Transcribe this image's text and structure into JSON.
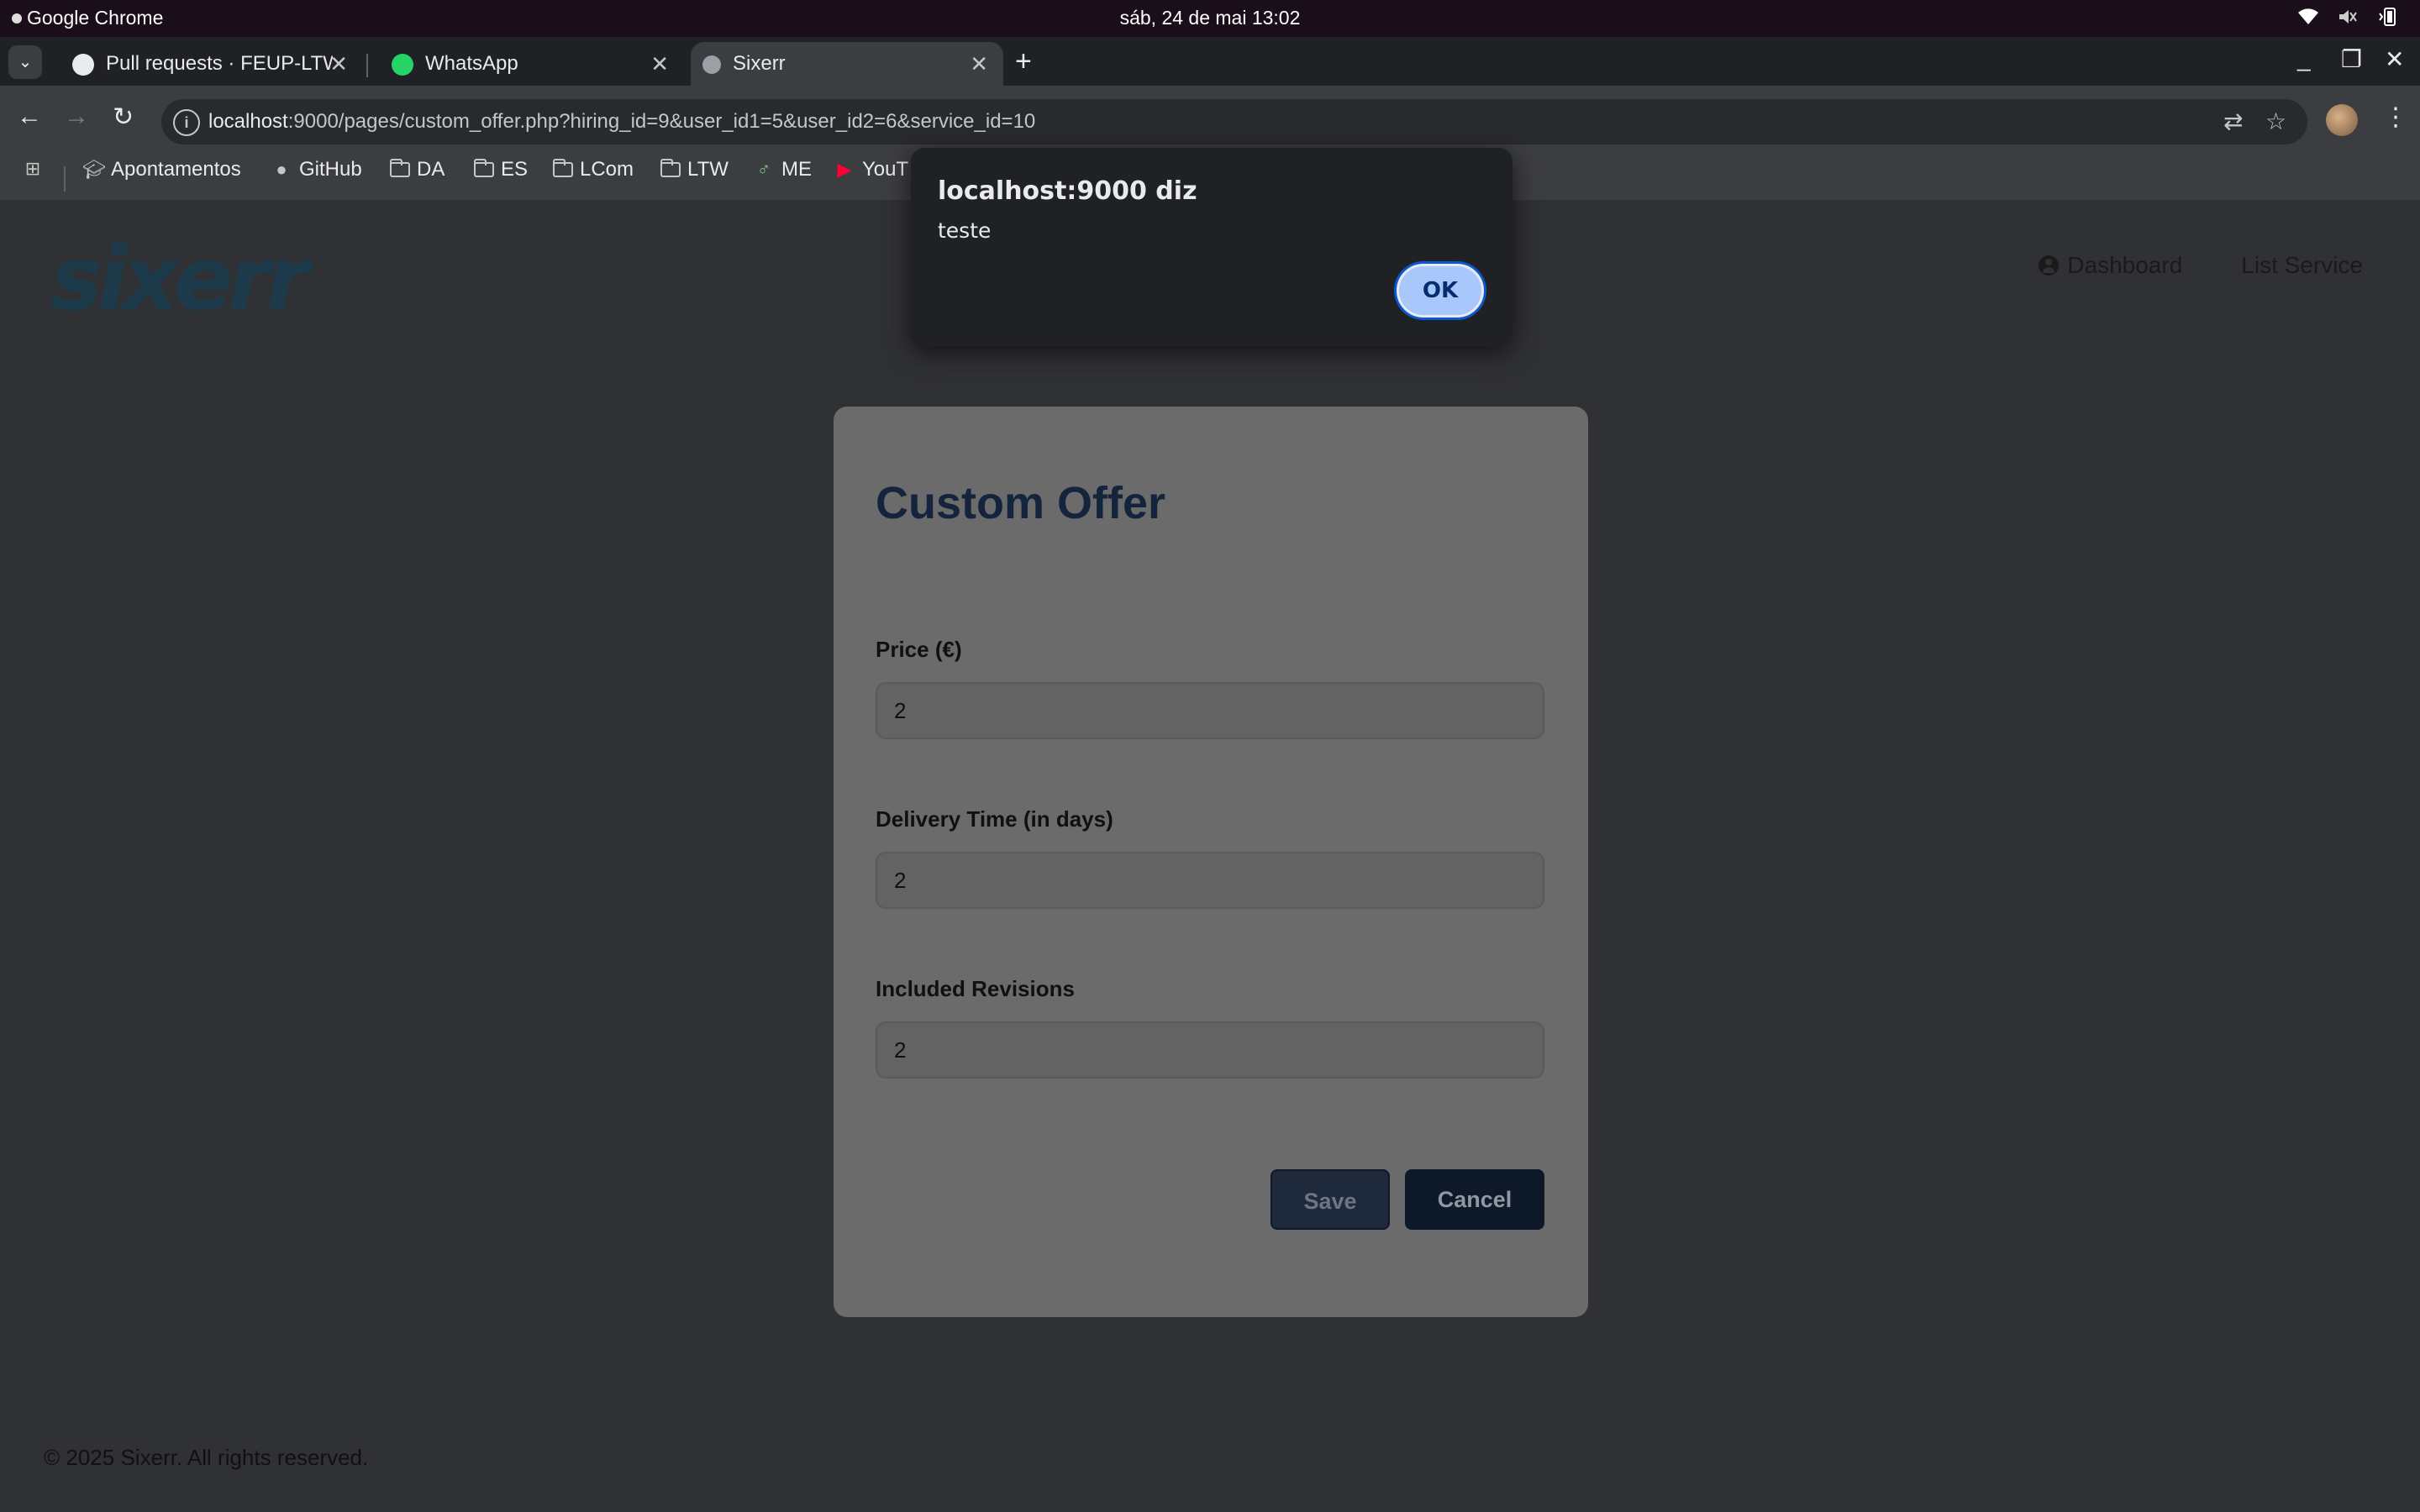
{
  "os": {
    "app_name": "Google Chrome",
    "clock": "sáb, 24 de mai  13:02"
  },
  "tabs": [
    {
      "title": "Pull requests · FEUP-LTW",
      "icon": "github-icon",
      "active": false
    },
    {
      "title": "WhatsApp",
      "icon": "whatsapp-icon",
      "active": false
    },
    {
      "title": "Sixerr",
      "icon": "globe-icon",
      "active": true
    }
  ],
  "toolbar": {
    "url_host": "localhost",
    "url_rest": ":9000/pages/custom_offer.php?hiring_id=9&user_id1=5&user_id2=6&service_id=10"
  },
  "bookmarks": [
    {
      "label": "Apontamentos",
      "icon": "graduation-cap-icon"
    },
    {
      "label": "GitHub",
      "icon": "github-icon"
    },
    {
      "label": "DA",
      "icon": "folder-icon"
    },
    {
      "label": "ES",
      "icon": "folder-icon"
    },
    {
      "label": "LCom",
      "icon": "folder-icon"
    },
    {
      "label": "LTW",
      "icon": "folder-icon"
    },
    {
      "label": "ME",
      "icon": "me-icon"
    },
    {
      "label": "YouT",
      "icon": "youtube-icon"
    }
  ],
  "site": {
    "logo": "sixerr",
    "nav": {
      "dashboard": "Dashboard",
      "list_service": "List Service"
    }
  },
  "form": {
    "title": "Custom Offer",
    "fields": [
      {
        "label": "Price (€)",
        "value": "2"
      },
      {
        "label": "Delivery Time (in days)",
        "value": "2"
      },
      {
        "label": "Included Revisions",
        "value": "2"
      }
    ],
    "save_label": "Save",
    "cancel_label": "Cancel"
  },
  "footer": {
    "text": "© 2025 Sixerr. All rights reserved."
  },
  "alert": {
    "title": "localhost:9000 diz",
    "message": "teste",
    "ok_label": "OK"
  }
}
